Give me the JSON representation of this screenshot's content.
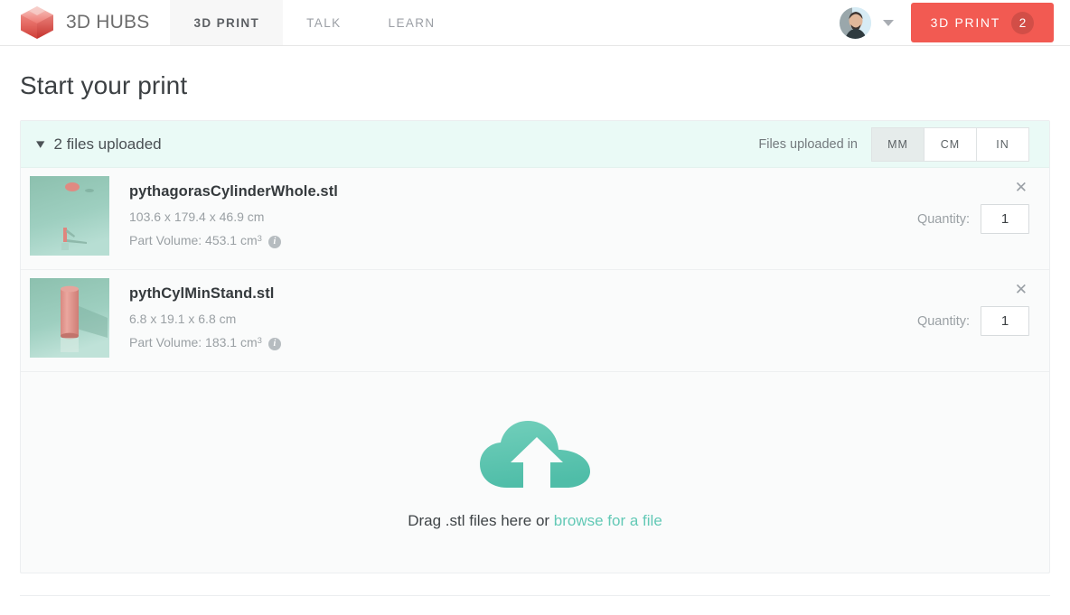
{
  "nav": {
    "brand": "3D HUBS",
    "logo_icon": "hexagon-cube-logo",
    "tabs": [
      {
        "label": "3D PRINT",
        "active": true
      },
      {
        "label": "TALK",
        "active": false
      },
      {
        "label": "LEARN",
        "active": false
      }
    ],
    "avatar_icon": "user-avatar",
    "caret_icon": "chevron-down-icon",
    "print_button": {
      "label": "3D PRINT",
      "badge": "2",
      "color": "#f25a52"
    }
  },
  "page": {
    "title": "Start your print"
  },
  "uploads": {
    "collapse_icon": "chevron-down-icon",
    "summary": "2 files uploaded",
    "units_label": "Files uploaded in",
    "units": [
      {
        "label": "MM",
        "selected": true
      },
      {
        "label": "CM",
        "selected": false
      },
      {
        "label": "IN",
        "selected": false
      }
    ],
    "files": [
      {
        "name": "pythagorasCylinderWhole.stl",
        "dimensions": "103.6 x 179.4 x 46.9 cm",
        "volume_label": "Part Volume: 453.1 cm",
        "volume_sup": "3",
        "info_icon": "info-icon",
        "remove_icon": "close-icon",
        "quantity_label": "Quantity:",
        "quantity": "1",
        "thumbnail_icon": "stl-preview-thumbnail"
      },
      {
        "name": "pythCylMinStand.stl",
        "dimensions": "6.8 x 19.1 x 6.8 cm",
        "volume_label": "Part Volume: 183.1 cm",
        "volume_sup": "3",
        "info_icon": "info-icon",
        "remove_icon": "close-icon",
        "quantity_label": "Quantity:",
        "quantity": "1",
        "thumbnail_icon": "stl-preview-thumbnail"
      }
    ],
    "dropzone": {
      "icon": "cloud-upload-icon",
      "text_before": "Drag .stl files here or ",
      "link": "browse for a file",
      "accent": "#63c9b6"
    }
  }
}
